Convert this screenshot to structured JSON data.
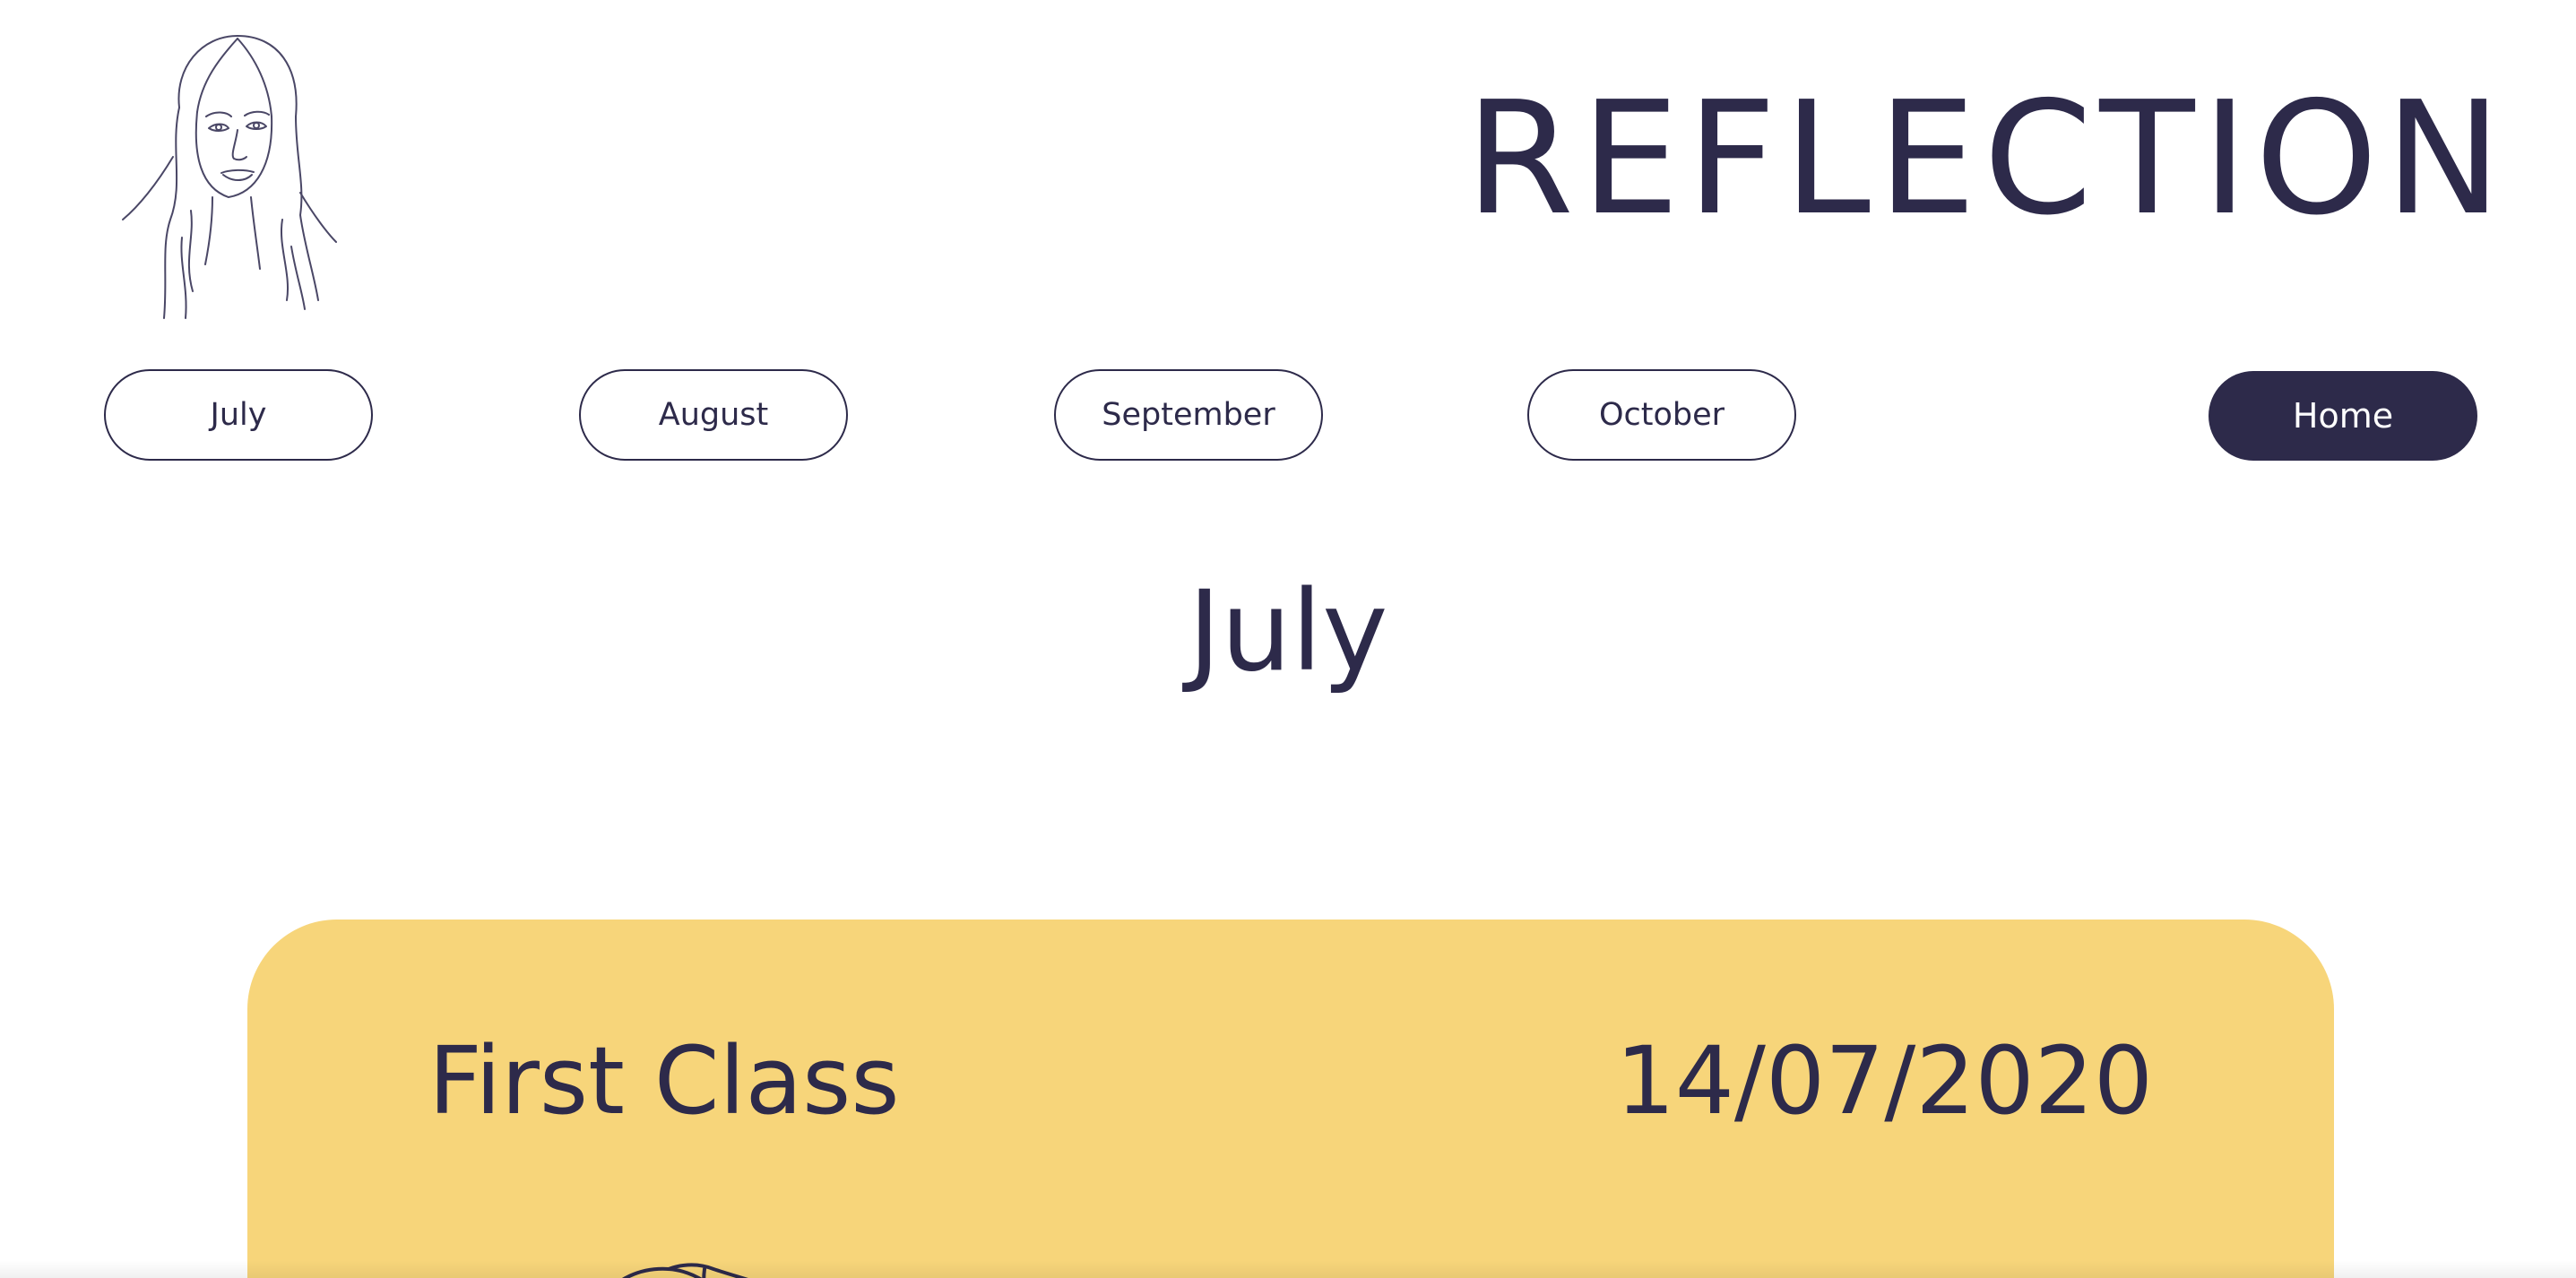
{
  "header": {
    "title": "REFLECTION",
    "portrait_icon": "portrait-line-drawing"
  },
  "nav": {
    "items": [
      {
        "label": "July"
      },
      {
        "label": "August"
      },
      {
        "label": "September"
      },
      {
        "label": "October"
      }
    ],
    "home_label": "Home"
  },
  "main": {
    "heading": "July",
    "card": {
      "title": "First Class",
      "date": "14/07/2020",
      "illustration_icon": "line-drawing-illustration"
    }
  },
  "colors": {
    "primary": "#2d2a4a",
    "card_background": "#f7d57a",
    "page_background": "#ffffff"
  }
}
